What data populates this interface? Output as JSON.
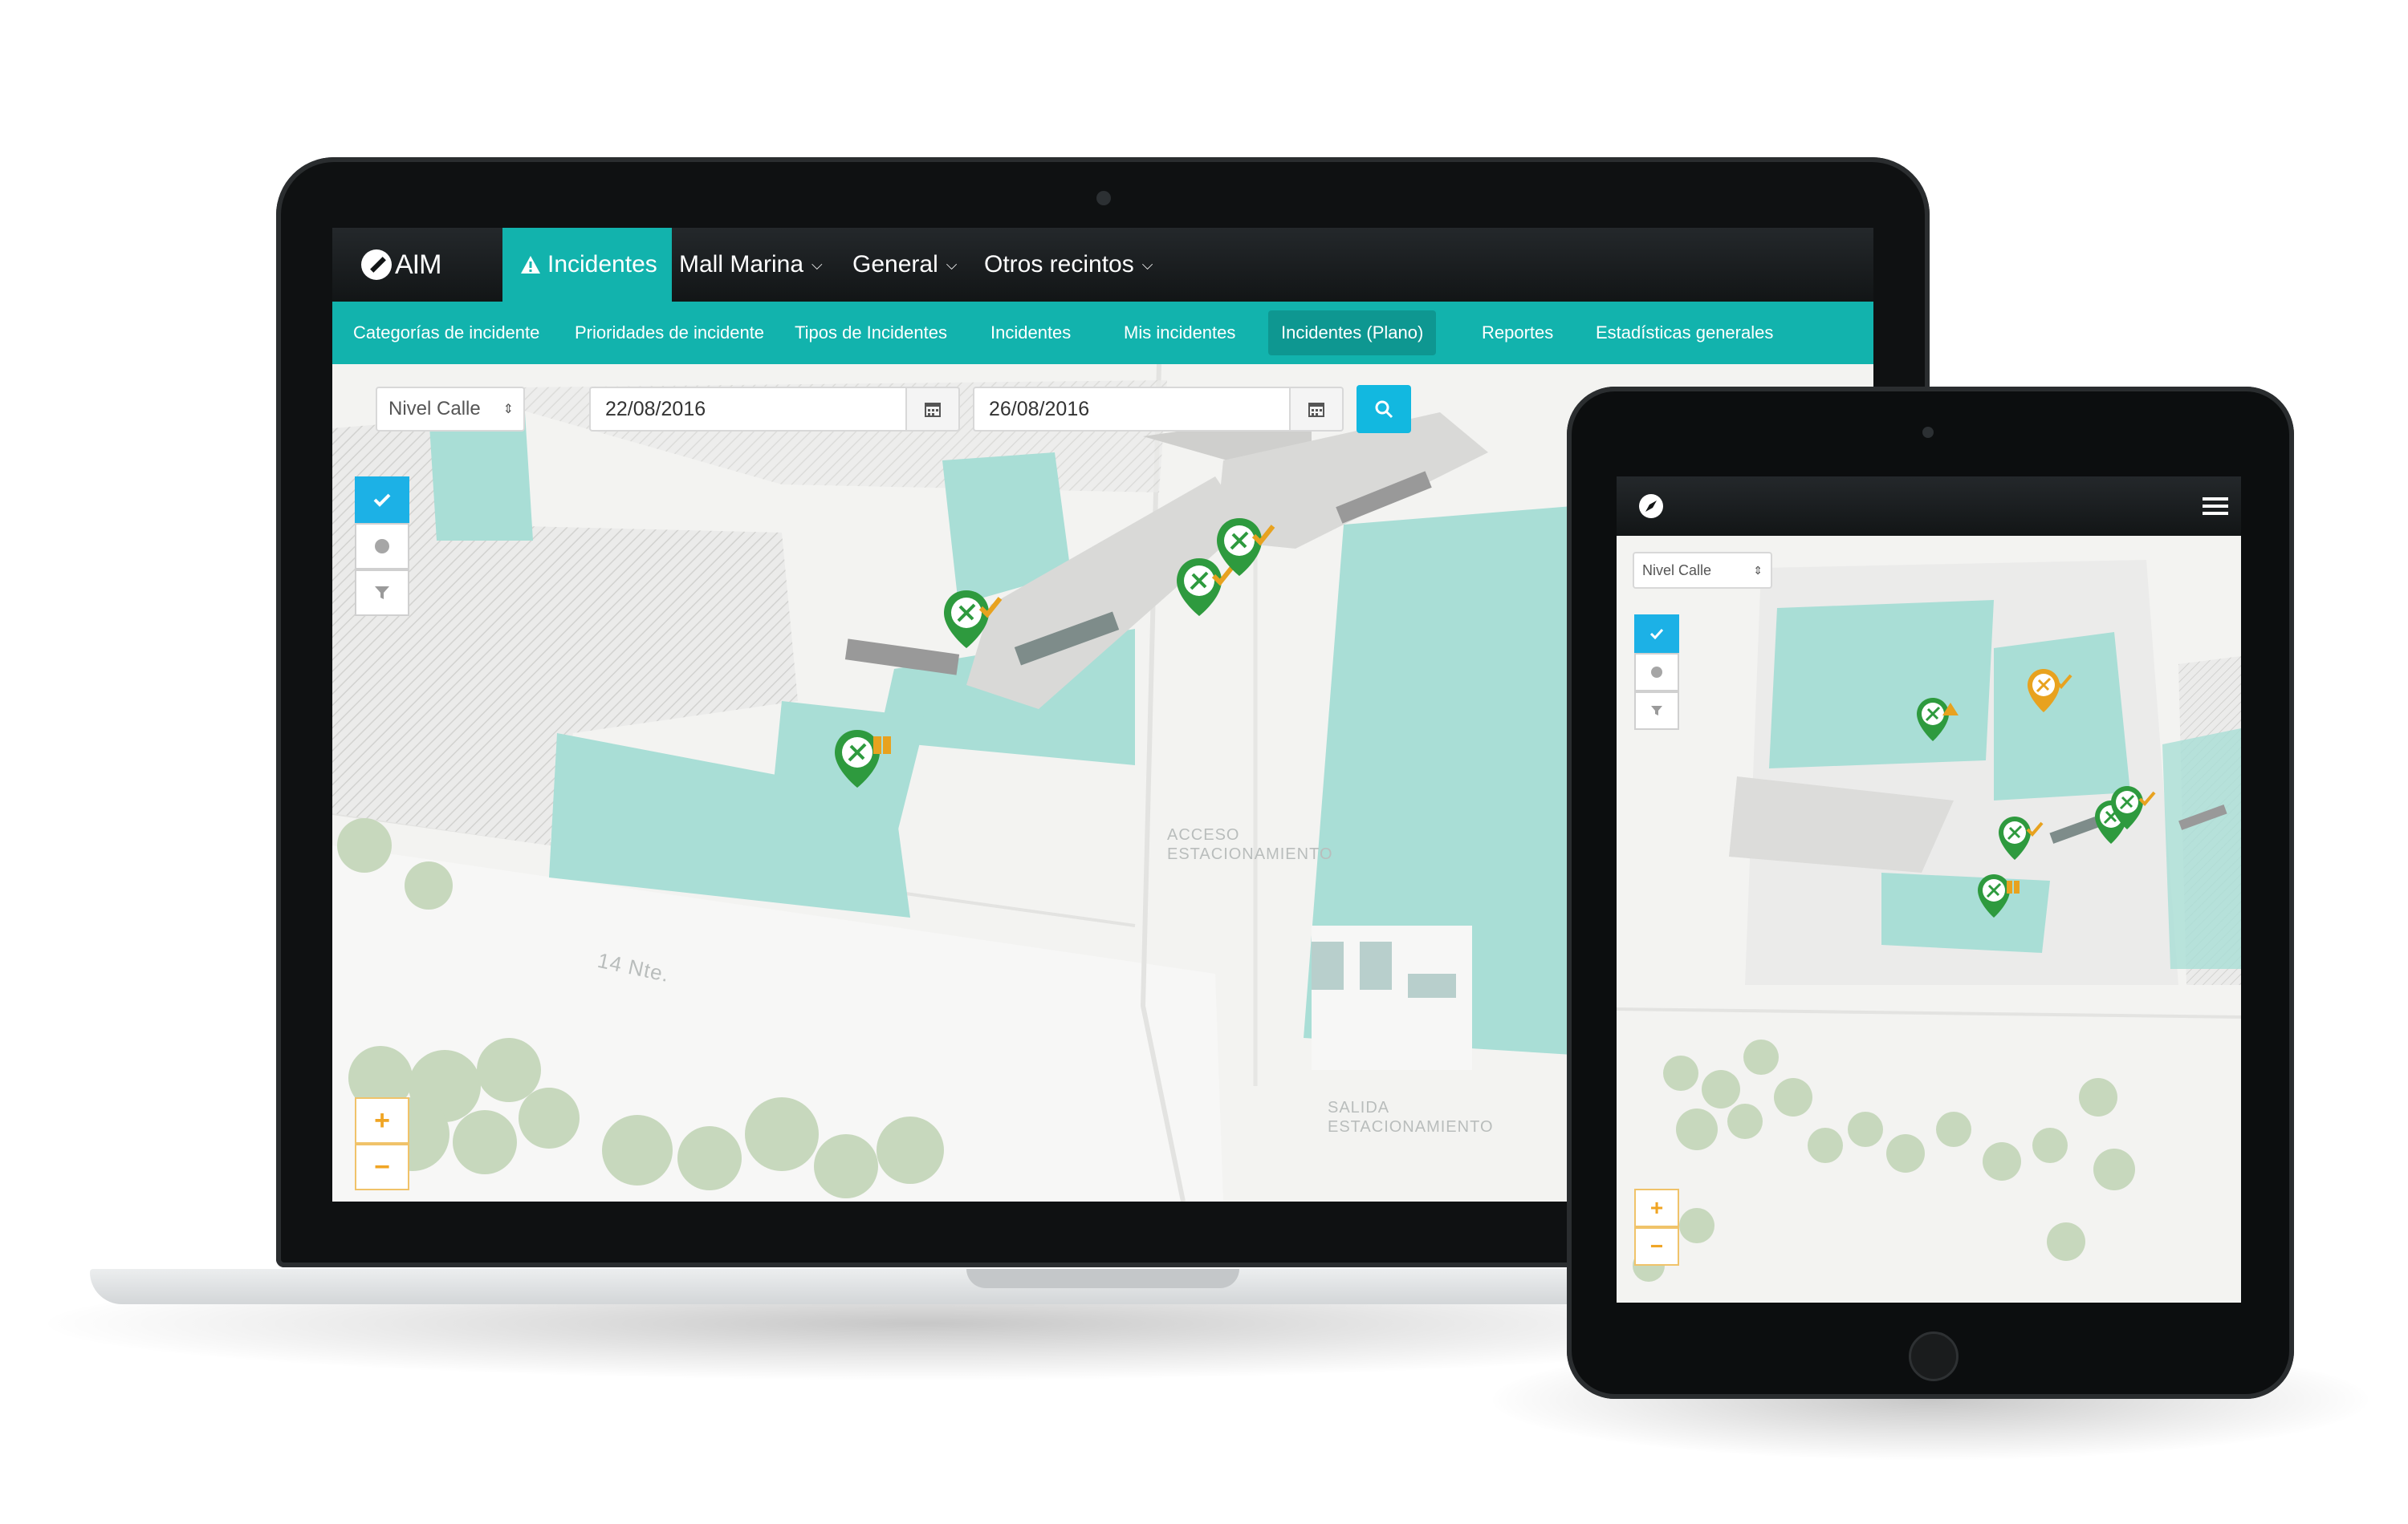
{
  "colors": {
    "accent": "#12b3ad",
    "accent_dark": "#0e9791",
    "search": "#12b8e0",
    "map_building": "#a9ded6",
    "marker_green": "#2e9a3e",
    "marker_orange": "#e8a21f",
    "zoom_orange": "#f0a524"
  },
  "laptop": {
    "topbar": {
      "logo_text": "AIM",
      "nav": [
        {
          "label": "Incidentes",
          "icon": "warning-icon",
          "active": true
        },
        {
          "label": "Mall Marina",
          "icon": "chevron-down-icon"
        },
        {
          "label": "General",
          "icon": "chevron-down-icon"
        },
        {
          "label": "Otros recintos",
          "icon": "chevron-down-icon"
        }
      ]
    },
    "subnav": [
      {
        "label": "Categorías de incidente"
      },
      {
        "label": "Prioridades de incidente"
      },
      {
        "label": "Tipos de Incidentes"
      },
      {
        "label": "Incidentes"
      },
      {
        "label": "Mis incidentes"
      },
      {
        "label": "Incidentes (Plano)",
        "active": true
      },
      {
        "label": "Reportes"
      },
      {
        "label": "Estadísticas generales"
      }
    ],
    "filters": {
      "level": "Nivel Calle",
      "date_from": "22/08/2016",
      "date_to": "26/08/2016"
    },
    "map_tools": {
      "check": "check-icon",
      "dot": "dot-icon",
      "filter": "filter-icon"
    },
    "zoom": {
      "in": "+",
      "out": "−"
    },
    "map_labels": {
      "street": "14 Nte.",
      "acceso": "ACCESO\nESTACIONAMIENTO",
      "salida": "SALIDA\nESTACIONAMIENTO"
    }
  },
  "tablet": {
    "filters": {
      "level": "Nivel Calle"
    },
    "zoom": {
      "in": "+",
      "out": "−"
    }
  }
}
